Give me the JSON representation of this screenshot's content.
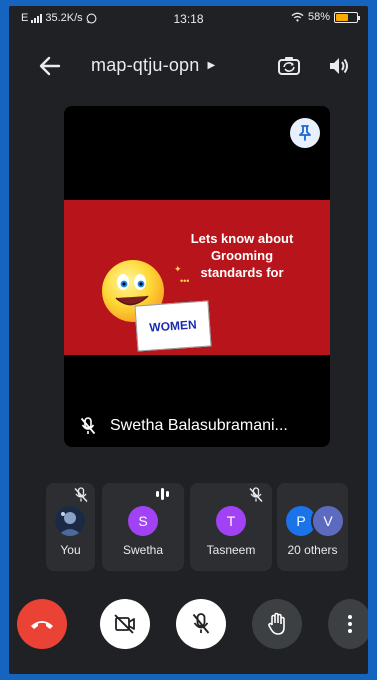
{
  "status_bar": {
    "network": "E",
    "speed": "35.2K/s",
    "time": "13:18",
    "battery": "58%",
    "battery_level": 0.58
  },
  "top_bar": {
    "meeting_code": "map-qtju-opn",
    "icons": [
      "back-arrow-icon",
      "switch-camera-icon",
      "speaker-icon"
    ]
  },
  "main_tile": {
    "slide": {
      "line1": "Lets know about",
      "line2": "Grooming",
      "line3": "standards for",
      "card_text": "WOMEN"
    },
    "speaker_name": "Swetha Balasubramani...",
    "icons": [
      "pin-icon",
      "mic-off-icon"
    ]
  },
  "participants": [
    {
      "label": "You",
      "muted": true
    },
    {
      "label": "Swetha",
      "initial": "S",
      "color": "#a142f4",
      "speaking": true
    },
    {
      "label": "Tasneem",
      "initial": "T",
      "color": "#a142f4",
      "muted": true
    },
    {
      "label": "20 others",
      "initials": [
        "P",
        "V"
      ],
      "colors": [
        "#1a73e8",
        "#5c6bc0"
      ]
    }
  ],
  "controls": {
    "buttons": [
      "end-call-button",
      "camera-off-button",
      "mic-off-button",
      "raise-hand-button",
      "more-options-button"
    ],
    "colors": {
      "end_call": "#ea4335",
      "active": "#ffffff",
      "dim": "#3c4043"
    }
  }
}
